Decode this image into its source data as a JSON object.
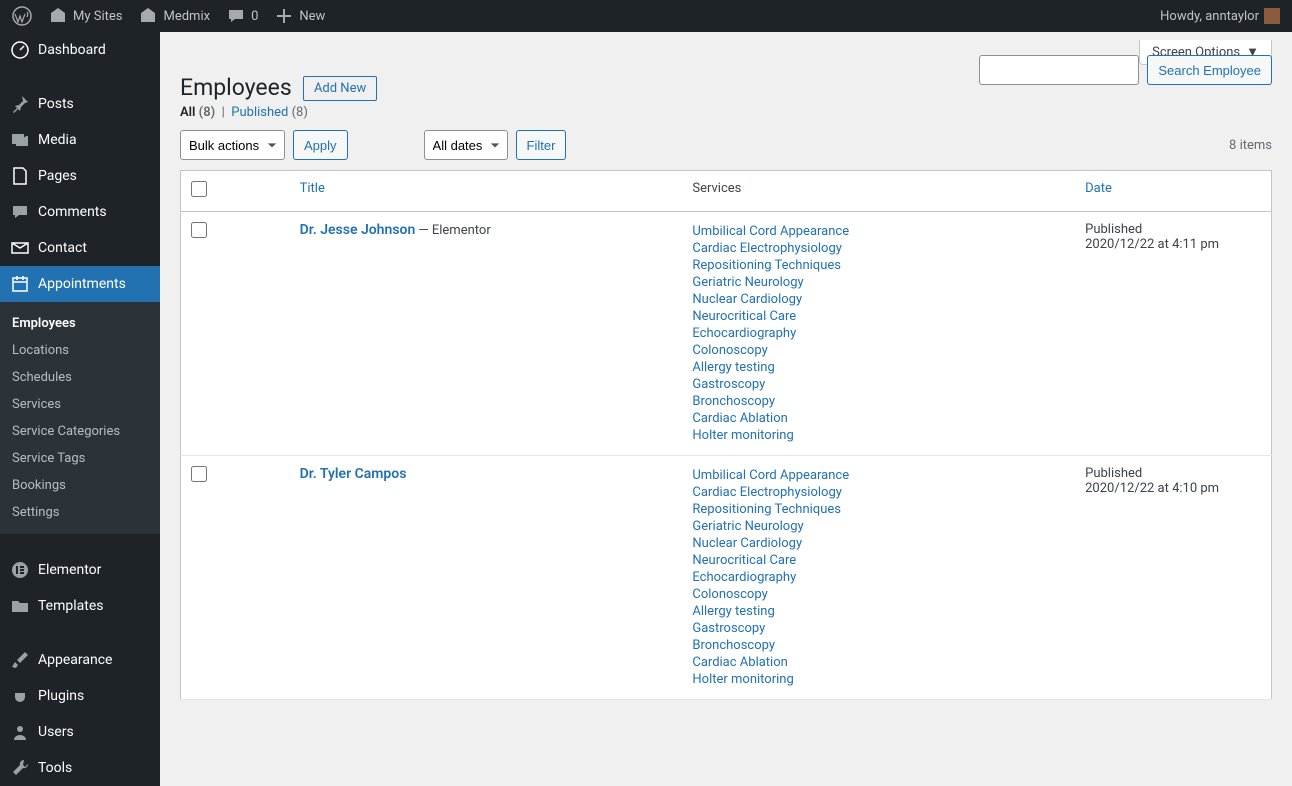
{
  "topbar": {
    "mysites": "My Sites",
    "site": "Medmix",
    "comments": "0",
    "new": "New",
    "howdy": "Howdy, anntaylor"
  },
  "sidebar": {
    "dashboard": "Dashboard",
    "posts": "Posts",
    "media": "Media",
    "pages": "Pages",
    "comments": "Comments",
    "contact": "Contact",
    "appointments": "Appointments",
    "elementor": "Elementor",
    "templates": "Templates",
    "appearance": "Appearance",
    "plugins": "Plugins",
    "users": "Users",
    "tools": "Tools"
  },
  "submenu": {
    "employees": "Employees",
    "locations": "Locations",
    "schedules": "Schedules",
    "services": "Services",
    "service_categories": "Service Categories",
    "service_tags": "Service Tags",
    "bookings": "Bookings",
    "settings": "Settings"
  },
  "screen_options": "Screen Options",
  "page": {
    "title": "Employees",
    "add_new": "Add New"
  },
  "filters": {
    "all": "All",
    "all_count": "(8)",
    "sep": "|",
    "published": "Published",
    "published_count": "(8)"
  },
  "controls": {
    "bulk": "Bulk actions",
    "apply": "Apply",
    "all_dates": "All dates",
    "filter": "Filter",
    "search": "Search Employee",
    "items": "8 items"
  },
  "table": {
    "title": "Title",
    "services": "Services",
    "date": "Date"
  },
  "rows": [
    {
      "title": "Dr. Jesse Johnson",
      "suffix": " — Elementor",
      "services": [
        "Umbilical Cord Appearance",
        "Cardiac Electrophysiology",
        "Repositioning Techniques",
        "Geriatric Neurology",
        "Nuclear Cardiology",
        "Neurocritical Care",
        "Echocardiography",
        "Colonoscopy",
        "Allergy testing",
        "Gastroscopy",
        "Bronchoscopy",
        "Cardiac Ablation",
        "Holter monitoring"
      ],
      "status": "Published",
      "when": "2020/12/22 at 4:11 pm"
    },
    {
      "title": "Dr. Tyler Campos",
      "suffix": "",
      "services": [
        "Umbilical Cord Appearance",
        "Cardiac Electrophysiology",
        "Repositioning Techniques",
        "Geriatric Neurology",
        "Nuclear Cardiology",
        "Neurocritical Care",
        "Echocardiography",
        "Colonoscopy",
        "Allergy testing",
        "Gastroscopy",
        "Bronchoscopy",
        "Cardiac Ablation",
        "Holter monitoring"
      ],
      "status": "Published",
      "when": "2020/12/22 at 4:10 pm"
    }
  ]
}
